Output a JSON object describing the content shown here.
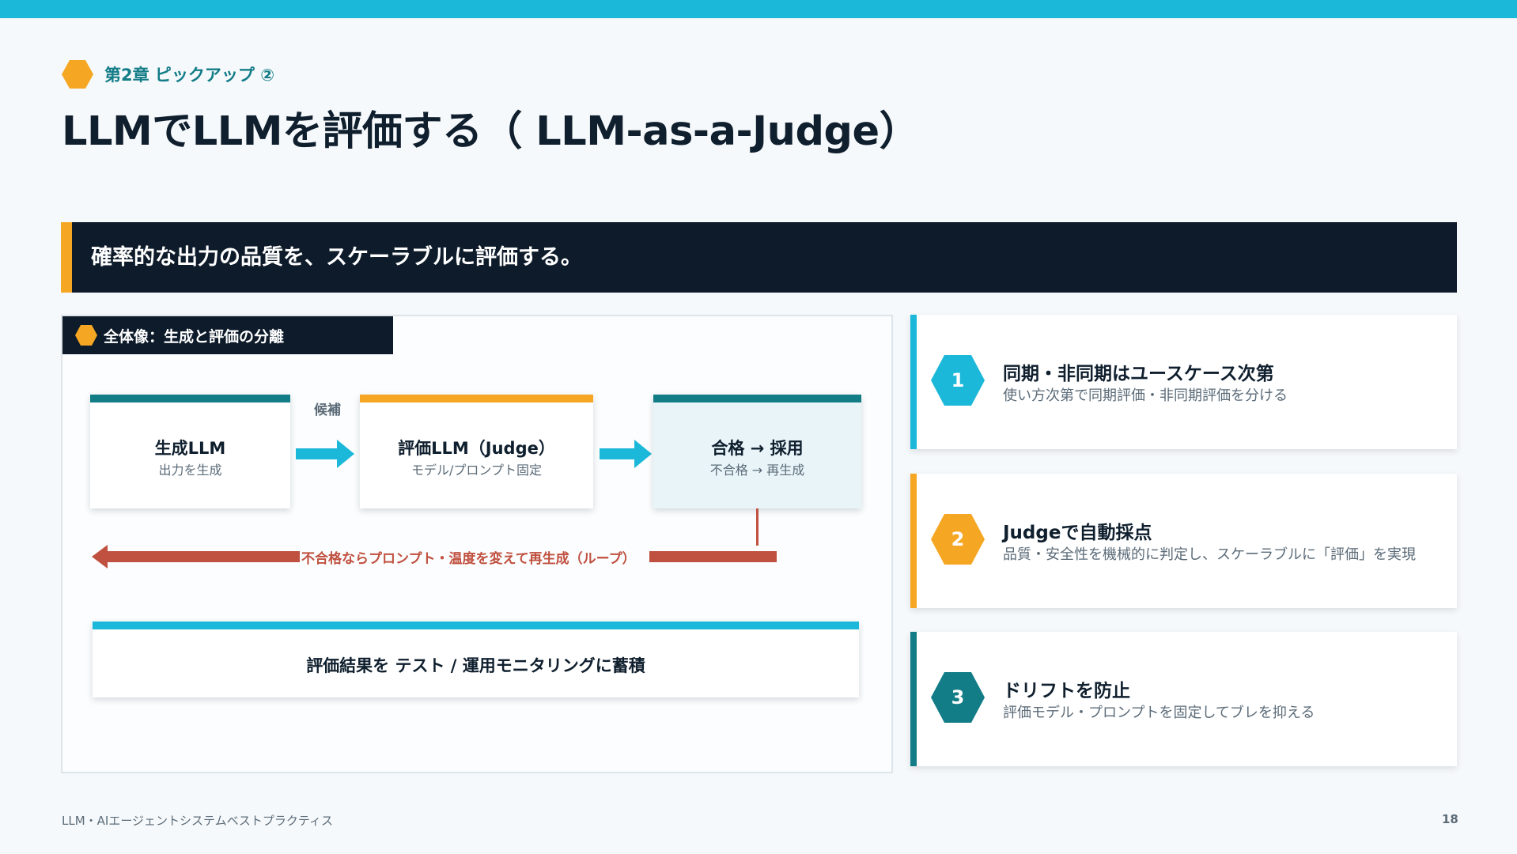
{
  "colors": {
    "accent_cyan": "#1cb8d9",
    "accent_orange": "#f5a623",
    "accent_teal": "#137d87",
    "loop_red": "#c0503f",
    "navy": "#0d1b2a"
  },
  "header": {
    "chapter": "第2章 ピックアップ ②",
    "title": "LLMでLLMを評価する（ LLM-as-a-Judge）"
  },
  "banner": {
    "text": "確率的な出力の品質を、スケーラブルに評価する。"
  },
  "diagram": {
    "tab_label": "全体像：生成と評価の分離",
    "edge_label": "候補",
    "nodes": [
      {
        "title": "生成LLM",
        "subtitle": "出力を生成"
      },
      {
        "title": "評価LLM（Judge）",
        "subtitle": "モデル/プロンプト固定"
      },
      {
        "title": "合格 → 採用",
        "subtitle": "不合格 → 再生成"
      }
    ],
    "loop_label": "不合格ならプロンプト・温度を変えて再生成（ループ）",
    "store_label": "評価結果を テスト / 運用モニタリングに蓄積"
  },
  "cards": [
    {
      "number": "1",
      "title": "同期・非同期はユースケース次第",
      "desc": "使い方次第で同期評価・非同期評価を分ける",
      "icon": "hexagon"
    },
    {
      "number": "2",
      "title": "Judgeで自動採点",
      "desc": "品質・安全性を機械的に判定し、スケーラブルに「評価」を実現",
      "icon": "hexagon"
    },
    {
      "number": "3",
      "title": "ドリフトを防止",
      "desc": "評価モデル・プロンプトを固定してブレを抑える",
      "icon": "hexagon"
    }
  ],
  "footer": {
    "text": "LLM・AIエージェントシステムベストプラクティス",
    "page": "18"
  }
}
